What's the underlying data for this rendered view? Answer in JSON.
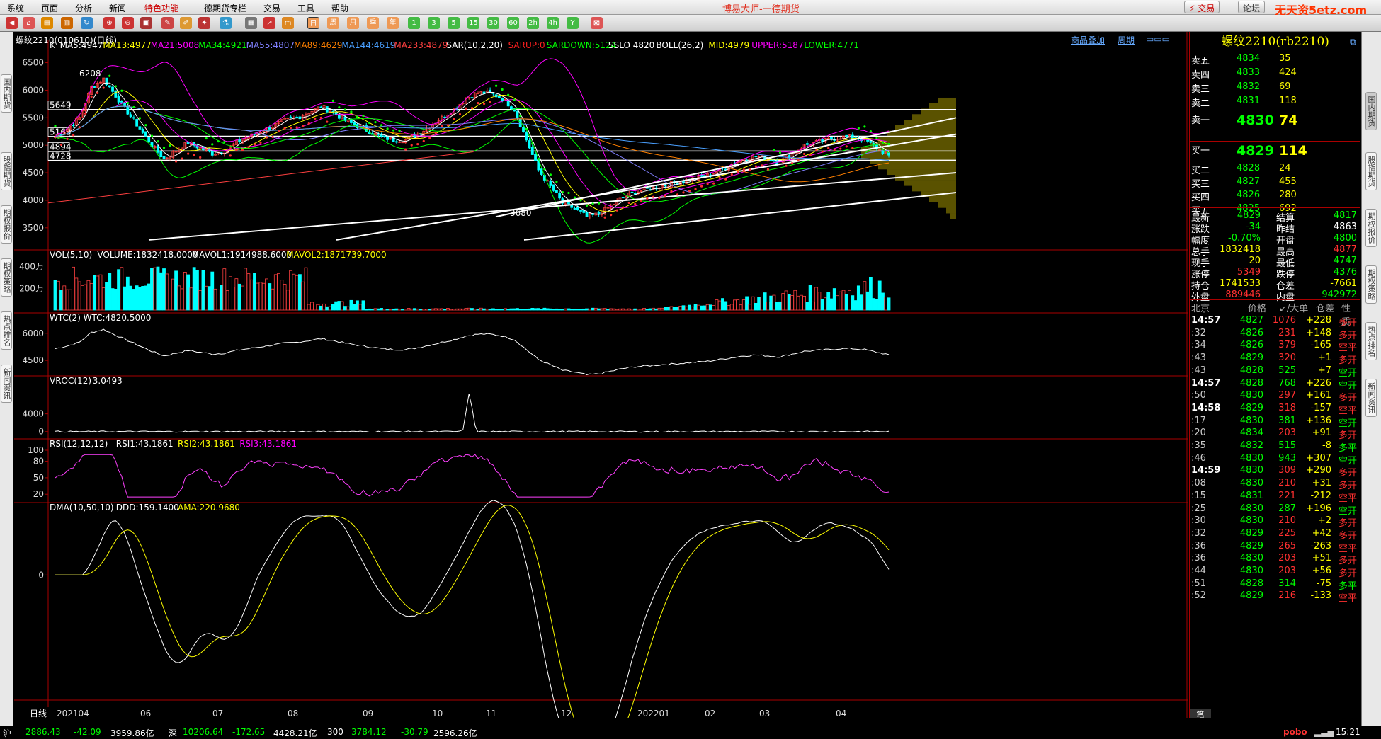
{
  "menu": [
    "系统",
    "页面",
    "分析",
    "新闻",
    "特色功能",
    "一德期货专栏",
    "交易",
    "工具",
    "帮助"
  ],
  "brand": "博易大师-一德期货",
  "top_buttons": {
    "trade": "⚡ 交易",
    "forum": "论坛"
  },
  "watermark": "无天资5etz.com",
  "chart_header": {
    "title": "螺纹2210(010610)(日线)",
    "links": [
      "商品叠加",
      "周期"
    ]
  },
  "left_tabs": [
    "国内期货",
    "股指期货",
    "期权报价",
    "期权策略",
    "热点排名",
    "新闻资讯"
  ],
  "right_tabs": [
    "国内期货",
    "股指期货",
    "期权报价",
    "期权策略",
    "热点排名",
    "新闻资讯"
  ],
  "indicator_lines": {
    "k": [
      {
        "text": "K",
        "color": "#ffffff"
      },
      {
        "text": "MA5:4947",
        "color": "#ffffff"
      },
      {
        "text": "MA13:4977",
        "color": "#ffff00"
      },
      {
        "text": "MA21:5008",
        "color": "#ff00ff"
      },
      {
        "text": "MA34:4921",
        "color": "#00ff00"
      },
      {
        "text": "MA55:4807",
        "color": "#8080ff"
      },
      {
        "text": "MA89:4629",
        "color": "#ff8000"
      },
      {
        "text": "MA144:4619",
        "color": "#4aa0ff"
      },
      {
        "text": "MA233:4879",
        "color": "#ff4040"
      },
      {
        "text": "SAR(10,2,20)",
        "color": "#ffffff"
      },
      {
        "text": "SARUP:0",
        "color": "#ff2020"
      },
      {
        "text": "SARDOWN:5124",
        "color": "#00ff00"
      },
      {
        "text": "SSLO 4820",
        "color": "#ffffff"
      },
      {
        "text": "BOLL(26,2)",
        "color": "#ffffff"
      },
      {
        "text": "MID:4979",
        "color": "#ffff00"
      },
      {
        "text": "UPPER:5187",
        "color": "#ff00ff"
      },
      {
        "text": "LOWER:4771",
        "color": "#00ff00"
      }
    ],
    "vol": [
      {
        "text": "VOL(5,10)",
        "color": "#ffffff"
      },
      {
        "text": "VOLUME:1832418.0000",
        "color": "#ffffff"
      },
      {
        "text": "MAVOL1:1914988.6000",
        "color": "#ffffff"
      },
      {
        "text": "MAVOL2:1871739.7000",
        "color": "#ffff00"
      }
    ],
    "wtc": [
      {
        "text": "WTC(2)",
        "color": "#ffffff"
      },
      {
        "text": "WTC:4820.5000",
        "color": "#ffffff"
      }
    ],
    "vroc": [
      {
        "text": "VROC(12)",
        "color": "#ffffff"
      },
      {
        "text": "3.0493",
        "color": "#ffffff"
      }
    ],
    "rsi": [
      {
        "text": "RSI(12,12,12)",
        "color": "#ffffff"
      },
      {
        "text": "RSI1:43.1861",
        "color": "#ffffff"
      },
      {
        "text": "RSI2:43.1861",
        "color": "#ffff00"
      },
      {
        "text": "RSI3:43.1861",
        "color": "#ff00ff"
      }
    ],
    "dma": [
      {
        "text": "DMA(10,50,10)",
        "color": "#ffffff"
      },
      {
        "text": "DDD:159.1400",
        "color": "#ffffff"
      },
      {
        "text": "AMA:220.9680",
        "color": "#ffff00"
      }
    ]
  },
  "chart_data": [
    {
      "type": "candlestick",
      "panel": "price",
      "y_ticks": [
        3500,
        4000,
        4500,
        5000,
        5500,
        6000,
        6500
      ],
      "ylim": [
        3150,
        6700
      ],
      "horizontal_levels": [
        5649,
        5163,
        4894,
        4728
      ],
      "annotations": [
        "6208",
        "3680"
      ],
      "close_path": [
        5150,
        5300,
        5500,
        6050,
        6208,
        5900,
        5600,
        5300,
        5000,
        4750,
        4900,
        5050,
        4950,
        4850,
        4900,
        5050,
        5150,
        5250,
        5350,
        5450,
        5500,
        5600,
        5700,
        5600,
        5450,
        5350,
        5250,
        5150,
        5100,
        5100,
        5200,
        5350,
        5500,
        5650,
        5850,
        5950,
        5950,
        5850,
        5650,
        5100,
        4550,
        4250,
        3950,
        3850,
        3700,
        3750,
        3900,
        4050,
        4150,
        4200,
        4250,
        4300,
        4350,
        4400,
        4450,
        4550,
        4650,
        4750,
        4800,
        4750,
        4700,
        4850,
        5000,
        5050,
        5100,
        5150,
        5150,
        5100,
        4950,
        4820
      ]
    },
    {
      "type": "bar",
      "panel": "volume",
      "y_ticks_labels": [
        "200万",
        "400万"
      ],
      "ylim": [
        0,
        4500000
      ]
    },
    {
      "type": "line",
      "panel": "wtc",
      "y_ticks": [
        4500,
        6000
      ],
      "ylim": [
        3800,
        6500
      ]
    },
    {
      "type": "line",
      "panel": "vroc",
      "y_ticks": [
        0,
        4000
      ],
      "ylim": [
        -1000,
        10000
      ]
    },
    {
      "type": "line",
      "panel": "rsi",
      "y_ticks": [
        20,
        50,
        80,
        100
      ],
      "ylim": [
        10,
        100
      ]
    },
    {
      "type": "line",
      "panel": "dma",
      "y_ticks": [
        0
      ],
      "ylim": [
        -800,
        400
      ]
    }
  ],
  "x_axis_labels": [
    "日线",
    "202104",
    "06",
    "07",
    "08",
    "09",
    "10",
    "11",
    "12",
    "202201",
    "02",
    "03",
    "04"
  ],
  "quote": {
    "title": "螺纹2210(rb2210)",
    "asks": [
      {
        "label": "卖五",
        "price": "4834",
        "vol": "35"
      },
      {
        "label": "卖四",
        "price": "4833",
        "vol": "424"
      },
      {
        "label": "卖三",
        "price": "4832",
        "vol": "69"
      },
      {
        "label": "卖二",
        "price": "4831",
        "vol": "118"
      },
      {
        "label": "卖一",
        "price": "4830",
        "vol": "74"
      }
    ],
    "bids": [
      {
        "label": "买一",
        "price": "4829",
        "vol": "114"
      },
      {
        "label": "买二",
        "price": "4828",
        "vol": "24"
      },
      {
        "label": "买三",
        "price": "4827",
        "vol": "455"
      },
      {
        "label": "买四",
        "price": "4826",
        "vol": "280"
      },
      {
        "label": "买五",
        "price": "4825",
        "vol": "692"
      }
    ],
    "stats": [
      {
        "l1": "最新",
        "v1": "4829",
        "c1": "#00ff00",
        "l2": "结算",
        "v2": "4817",
        "c2": "#00ff00"
      },
      {
        "l1": "涨跌",
        "v1": "-34",
        "c1": "#00ff00",
        "l2": "昨结",
        "v2": "4863",
        "c2": "#ffffff"
      },
      {
        "l1": "幅度",
        "v1": "-0.70%",
        "c1": "#00ff00",
        "l2": "开盘",
        "v2": "4800",
        "c2": "#00ff00"
      },
      {
        "l1": "总手",
        "v1": "1832418",
        "c1": "#ffff00",
        "l2": "最高",
        "v2": "4877",
        "c2": "#ff3030"
      },
      {
        "l1": "现手",
        "v1": "20",
        "c1": "#ffff00",
        "l2": "最低",
        "v2": "4747",
        "c2": "#00ff00"
      },
      {
        "l1": "涨停",
        "v1": "5349",
        "c1": "#ff3030",
        "l2": "跌停",
        "v2": "4376",
        "c2": "#00ff00"
      },
      {
        "l1": "持仓",
        "v1": "1741533",
        "c1": "#ffff00",
        "l2": "仓差",
        "v2": "-7661",
        "c2": "#ffff00"
      },
      {
        "l1": "外盘",
        "v1": "889446",
        "c1": "#ff3030",
        "l2": "内盘",
        "v2": "942972",
        "c2": "#00ff00"
      }
    ],
    "tick_header": [
      "北京",
      "价格",
      "↙/大单",
      "仓差",
      "性质"
    ],
    "ticks": [
      {
        "t": "14:57",
        "p": "4827",
        "v": "1076",
        "d": "+228",
        "n": "多开",
        "vc": "#ff3030",
        "nc": "#ff3030"
      },
      {
        "t": ":32",
        "p": "4826",
        "v": "231",
        "d": "+148",
        "n": "多开",
        "vc": "#ff3030",
        "nc": "#ff3030"
      },
      {
        "t": ":34",
        "p": "4826",
        "v": "379",
        "d": "-165",
        "n": "空平",
        "vc": "#ff3030",
        "nc": "#ff3030"
      },
      {
        "t": ":43",
        "p": "4829",
        "v": "320",
        "d": "+1",
        "n": "多开",
        "vc": "#ff3030",
        "nc": "#ff3030"
      },
      {
        "t": ":43",
        "p": "4828",
        "v": "525",
        "d": "+7",
        "n": "空开",
        "vc": "#00ff00",
        "nc": "#00ff00"
      },
      {
        "t": "14:57",
        "p": "4828",
        "v": "768",
        "d": "+226",
        "n": "空开",
        "vc": "#00ff00",
        "nc": "#00ff00"
      },
      {
        "t": ":50",
        "p": "4830",
        "v": "297",
        "d": "+161",
        "n": "多开",
        "vc": "#ff3030",
        "nc": "#ff3030"
      },
      {
        "t": "14:58",
        "p": "4829",
        "v": "318",
        "d": "-157",
        "n": "空平",
        "vc": "#ff3030",
        "nc": "#ff3030"
      },
      {
        "t": ":17",
        "p": "4830",
        "v": "381",
        "d": "+136",
        "n": "空开",
        "vc": "#00ff00",
        "nc": "#00ff00"
      },
      {
        "t": ":20",
        "p": "4834",
        "v": "203",
        "d": "+91",
        "n": "多开",
        "vc": "#ff3030",
        "nc": "#ff3030"
      },
      {
        "t": ":35",
        "p": "4832",
        "v": "515",
        "d": "-8",
        "n": "多平",
        "vc": "#00ff00",
        "nc": "#00ff00"
      },
      {
        "t": ":46",
        "p": "4830",
        "v": "943",
        "d": "+307",
        "n": "空开",
        "vc": "#00ff00",
        "nc": "#00ff00"
      },
      {
        "t": "14:59",
        "p": "4830",
        "v": "309",
        "d": "+290",
        "n": "多开",
        "vc": "#ff3030",
        "nc": "#ff3030"
      },
      {
        "t": ":08",
        "p": "4830",
        "v": "210",
        "d": "+31",
        "n": "多开",
        "vc": "#ff3030",
        "nc": "#ff3030"
      },
      {
        "t": ":15",
        "p": "4831",
        "v": "221",
        "d": "-212",
        "n": "空平",
        "vc": "#ff3030",
        "nc": "#ff3030"
      },
      {
        "t": ":25",
        "p": "4830",
        "v": "287",
        "d": "+196",
        "n": "空开",
        "vc": "#00ff00",
        "nc": "#00ff00"
      },
      {
        "t": ":30",
        "p": "4830",
        "v": "210",
        "d": "+2",
        "n": "多开",
        "vc": "#ff3030",
        "nc": "#ff3030"
      },
      {
        "t": ":32",
        "p": "4829",
        "v": "225",
        "d": "+42",
        "n": "多开",
        "vc": "#ff3030",
        "nc": "#ff3030"
      },
      {
        "t": ":36",
        "p": "4829",
        "v": "265",
        "d": "-263",
        "n": "空平",
        "vc": "#ff3030",
        "nc": "#ff3030"
      },
      {
        "t": ":36",
        "p": "4830",
        "v": "203",
        "d": "+51",
        "n": "多开",
        "vc": "#ff3030",
        "nc": "#ff3030"
      },
      {
        "t": ":44",
        "p": "4830",
        "v": "203",
        "d": "+56",
        "n": "多开",
        "vc": "#ff3030",
        "nc": "#ff3030"
      },
      {
        "t": ":51",
        "p": "4828",
        "v": "314",
        "d": "-75",
        "n": "多平",
        "vc": "#00ff00",
        "nc": "#00ff00"
      },
      {
        "t": ":52",
        "p": "4829",
        "v": "216",
        "d": "-133",
        "n": "空平",
        "vc": "#ff3030",
        "nc": "#ff3030"
      }
    ],
    "footer_tab": "笔"
  },
  "status": {
    "sh": {
      "name": "沪",
      "value": "2886.43",
      "chg": "-42.09",
      "amt": "3959.86亿"
    },
    "sz": {
      "name": "深",
      "value": "10206.64",
      "chg": "-172.65",
      "amt": "4428.21亿"
    },
    "hs300": {
      "name": "300",
      "value": "3784.12",
      "chg": "-30.79",
      "amt": "2596.26亿"
    },
    "logo": "pobo",
    "time": "15:21"
  }
}
